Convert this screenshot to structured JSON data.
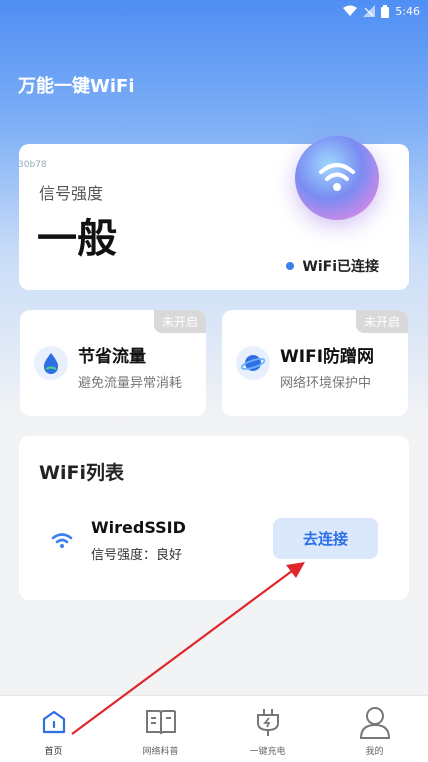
{
  "status_bar": {
    "time": "5:46"
  },
  "app": {
    "title": "万能一键WiFi",
    "watermark": "30b78"
  },
  "signal_card": {
    "label": "信号强度",
    "value": "一般",
    "status": "WiFi已连接",
    "icon": "wifi-orb-icon"
  },
  "features": [
    {
      "title": "节省流量",
      "subtitle": "避免流量异常消耗",
      "tag": "未开启",
      "icon": "water-drop-icon"
    },
    {
      "title": "WIFI防蹭网",
      "subtitle": "网络环境保护中",
      "tag": "未开启",
      "icon": "planet-icon"
    }
  ],
  "wifi_list": {
    "title": "WiFi列表",
    "items": [
      {
        "ssid": "WiredSSID",
        "strength": "信号强度：良好",
        "action": "去连接"
      }
    ]
  },
  "tabbar": {
    "items": [
      {
        "label": "首页",
        "icon": "home-icon",
        "active": true
      },
      {
        "label": "网络科普",
        "icon": "book-icon",
        "active": false
      },
      {
        "label": "一键充电",
        "icon": "charge-plug-icon",
        "active": false
      },
      {
        "label": "我的",
        "icon": "user-icon",
        "active": false
      }
    ]
  },
  "colors": {
    "accent": "#3b7ff0",
    "annotation_arrow": "#e0262b"
  }
}
